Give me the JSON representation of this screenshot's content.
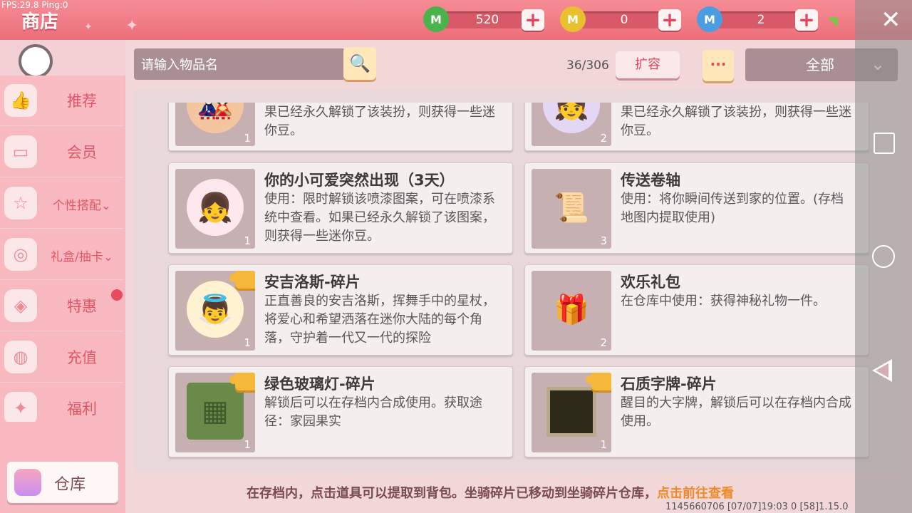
{
  "debug": {
    "fps": "FPS:29.8  Ping:0"
  },
  "header": {
    "title": "商店",
    "currencies": [
      {
        "icon": "green-gem-icon",
        "value": "520",
        "color": "#4bb34b",
        "glyph": "M"
      },
      {
        "icon": "gold-coin-icon",
        "value": "0",
        "color": "#e9c12e",
        "glyph": "M"
      },
      {
        "icon": "blue-coin-icon",
        "value": "2",
        "color": "#4a9de0",
        "glyph": "M"
      }
    ],
    "plus_glyph": "+",
    "close_glyph": "✕"
  },
  "sidebar": {
    "items": [
      {
        "label": "推荐",
        "icon": "thumbs-up-icon",
        "glyph": "👍"
      },
      {
        "label": "会员",
        "icon": "member-card-icon",
        "glyph": "▭"
      },
      {
        "label": "个性搭配",
        "icon": "cup-icon",
        "glyph": "☆",
        "chevron": "⌄"
      },
      {
        "label": "礼盒/抽卡",
        "icon": "gift-search-icon",
        "glyph": "◎",
        "chevron": "⌄"
      },
      {
        "label": "特惠",
        "icon": "gift-box-icon",
        "glyph": "◈"
      },
      {
        "label": "充值",
        "icon": "coins-icon",
        "glyph": "◍"
      },
      {
        "label": "福利",
        "icon": "welfare-icon",
        "glyph": "✦"
      }
    ],
    "warehouse_label": "仓库"
  },
  "toolbar": {
    "search_placeholder": "请输入物品名",
    "search_glyph": "🔍",
    "count": "36/306",
    "expand_label": "扩容",
    "more_label": "···",
    "filter_value": "全部",
    "filter_chevron": "⌄"
  },
  "items": [
    {
      "name": "",
      "desc": "果已经永久解锁了该装扮，则获得一些迷你豆。",
      "qty": "1",
      "art": "🎎",
      "art_bg": "#f3c6a0",
      "puzzle": false
    },
    {
      "name": "",
      "desc": "果已经永久解锁了该装扮，则获得一些迷你豆。",
      "qty": "2",
      "art": "👧",
      "art_bg": "#e4d6f5",
      "puzzle": false
    },
    {
      "name": "你的小可爱突然出现（3天）",
      "desc": "使用：限时解锁该喷漆图案，可在喷漆系统中查看。如果已经永久解锁了该图案，则获得一些迷你豆。",
      "qty": "1",
      "art": "👧",
      "art_bg": "#fde8ee",
      "puzzle": false
    },
    {
      "name": "传送卷轴",
      "desc": "使用：将你瞬间传送到家的位置。(存档地图内提取使用)",
      "qty": "3",
      "art": "📜",
      "art_bg": "#c7b0b2",
      "puzzle": false
    },
    {
      "name": "安吉洛斯-碎片",
      "desc": "正直善良的安吉洛斯，挥舞手中的星杖，将爱心和希望洒落在迷你大陆的每个角落，守护着一代又一代的探险",
      "qty": "1",
      "art": "👼",
      "art_bg": "#fff2d0",
      "puzzle": true
    },
    {
      "name": "欢乐礼包",
      "desc": "在仓库中使用：获得神秘礼物一件。",
      "qty": "2",
      "art": "🎁",
      "art_bg": "#c7b0b2",
      "puzzle": false
    },
    {
      "name": "绿色玻璃灯-碎片",
      "desc": "解锁后可以在存档内合成使用。获取途径：家园果实",
      "qty": "1",
      "art": "▦",
      "art_bg": "#6a8a4a",
      "puzzle": true
    },
    {
      "name": "石质字牌-碎片",
      "desc": "醒目的大字牌，解锁后可以在存档内合成使用。",
      "qty": "1",
      "art": "▣",
      "art_bg": "#2e2a1a",
      "puzzle": true
    }
  ],
  "footer": {
    "note": "在存档内，点击道具可以提取到背包。坐骑碎片已移动到坐骑碎片仓库，",
    "link": "点击前往查看",
    "meta": "1145660706   [07/07]19:03 0   [58]1.15.0"
  }
}
